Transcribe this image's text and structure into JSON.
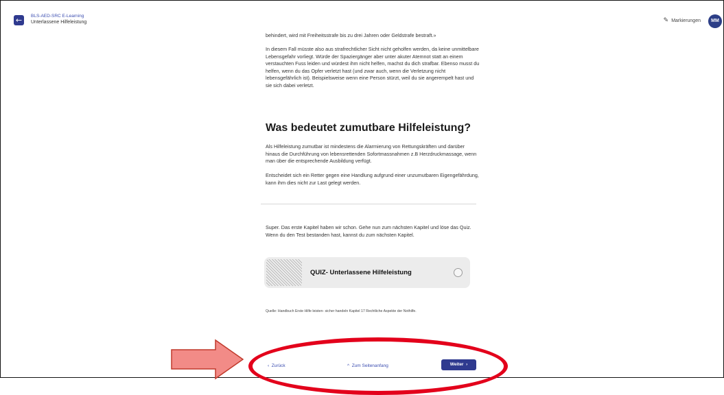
{
  "header": {
    "course_title": "BLS-AED-SRC E-Learning",
    "lesson_title": "Unterlassene Hilfeleistung",
    "back_icon": "arrow-left-icon",
    "markings_label": "Markierungen",
    "avatar_initials": "MM"
  },
  "content": {
    "p1": "behindert, wird mit Freiheitsstrafe bis zu drei Jahren oder Geldstrafe bestraft.»",
    "p2": "In diesem Fall müsste also aus strafrechtlicher Sicht nicht geholfen werden, da keine unmittelbare Lebensgefahr vorliegt. Würde der Spaziergänger aber unter akuter Atemnot statt an einem verstauchten Fuss leiden und würdest ihm nicht helfen, machst du dich strafbar. Ebenso musst du helfen, wenn du das Opfer verletzt hast (und zwar auch, wenn die Verletzung nicht lebensgefährlich ist). Beispielsweise wenn eine Person stürzt, weil du sie angerempelt hast und sie sich dabei verletzt.",
    "heading": "Was bedeutet zumutbare Hilfeleistung?",
    "p3": "Als Hilfeleistung zumutbar ist mindestens die Alarmierung von Rettungskräften und darüber hinaus die Durchführung von lebensrettenden Sofortmassnahmen z.B Herzdruckmassage, wenn man über die entsprechende Ausbildung verfügt.",
    "p4": "Entscheidet sich ein Retter gegen eine Handlung aufgrund einer unzumutbaren Eigengefährdung, kann ihm dies nicht zur Last gelegt werden.",
    "p5": "Super. Das erste Kapitel haben wir schon. Gehe nun zum nächsten Kapitel und löse das Quiz. Wenn du den Test bestanden hast, kannst du zum nächsten Kapitel.",
    "quiz_title": "QUIZ- Unterlassene Hilfeleistung",
    "source": "Quelle: Handbuch Erste Hilfe leisten- sicher handeln Kapitel 17 Rechtliche Aspekte der Nothilfe."
  },
  "footer": {
    "prev_label": "Zurück",
    "top_label": "Zum Seitenanfang",
    "next_label": "Weiter"
  },
  "colors": {
    "accent": "#2f3a8f",
    "annotation": "#e3001b",
    "arrow_fill": "#f28b87"
  }
}
